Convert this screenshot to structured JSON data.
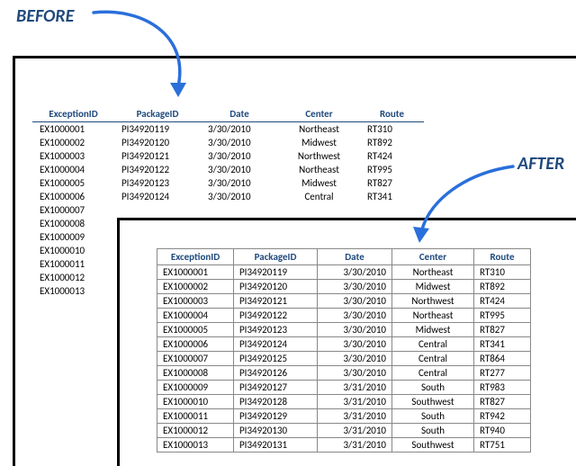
{
  "labels": {
    "before": "BEFORE",
    "after": "AFTER"
  },
  "columns": {
    "exception": "ExceptionID",
    "package": "PackageID",
    "date": "Date",
    "center": "Center",
    "route": "Route"
  },
  "before_rows": [
    {
      "exception": "EX1000001",
      "package": "PI34920119",
      "date": "3/30/2010",
      "center": "Northeast",
      "route": "RT310"
    },
    {
      "exception": "EX1000002",
      "package": "PI34920120",
      "date": "3/30/2010",
      "center": "Midwest",
      "route": "RT892"
    },
    {
      "exception": "EX1000003",
      "package": "PI34920121",
      "date": "3/30/2010",
      "center": "Northwest",
      "route": "RT424"
    },
    {
      "exception": "EX1000004",
      "package": "PI34920122",
      "date": "3/30/2010",
      "center": "Northeast",
      "route": "RT995"
    },
    {
      "exception": "EX1000005",
      "package": "PI34920123",
      "date": "3/30/2010",
      "center": "Midwest",
      "route": "RT827"
    },
    {
      "exception": "EX1000006",
      "package": "PI34920124",
      "date": "3/30/2010",
      "center": "Central",
      "route": "RT341"
    },
    {
      "exception": "EX1000007",
      "package": "",
      "date": "",
      "center": "",
      "route": ""
    },
    {
      "exception": "EX1000008",
      "package": "",
      "date": "",
      "center": "",
      "route": ""
    },
    {
      "exception": "EX1000009",
      "package": "",
      "date": "",
      "center": "",
      "route": ""
    },
    {
      "exception": "EX1000010",
      "package": "",
      "date": "",
      "center": "",
      "route": ""
    },
    {
      "exception": "EX1000011",
      "package": "",
      "date": "",
      "center": "",
      "route": ""
    },
    {
      "exception": "EX1000012",
      "package": "",
      "date": "",
      "center": "",
      "route": ""
    },
    {
      "exception": "EX1000013",
      "package": "",
      "date": "",
      "center": "",
      "route": ""
    }
  ],
  "after_rows": [
    {
      "exception": "EX1000001",
      "package": "PI34920119",
      "date": "3/30/2010",
      "center": "Northeast",
      "route": "RT310"
    },
    {
      "exception": "EX1000002",
      "package": "PI34920120",
      "date": "3/30/2010",
      "center": "Midwest",
      "route": "RT892"
    },
    {
      "exception": "EX1000003",
      "package": "PI34920121",
      "date": "3/30/2010",
      "center": "Northwest",
      "route": "RT424"
    },
    {
      "exception": "EX1000004",
      "package": "PI34920122",
      "date": "3/30/2010",
      "center": "Northeast",
      "route": "RT995"
    },
    {
      "exception": "EX1000005",
      "package": "PI34920123",
      "date": "3/30/2010",
      "center": "Midwest",
      "route": "RT827"
    },
    {
      "exception": "EX1000006",
      "package": "PI34920124",
      "date": "3/30/2010",
      "center": "Central",
      "route": "RT341"
    },
    {
      "exception": "EX1000007",
      "package": "PI34920125",
      "date": "3/30/2010",
      "center": "Central",
      "route": "RT864"
    },
    {
      "exception": "EX1000008",
      "package": "PI34920126",
      "date": "3/30/2010",
      "center": "Central",
      "route": "RT277"
    },
    {
      "exception": "EX1000009",
      "package": "PI34920127",
      "date": "3/31/2010",
      "center": "South",
      "route": "RT983"
    },
    {
      "exception": "EX1000010",
      "package": "PI34920128",
      "date": "3/31/2010",
      "center": "Southwest",
      "route": "RT827"
    },
    {
      "exception": "EX1000011",
      "package": "PI34920129",
      "date": "3/31/2010",
      "center": "South",
      "route": "RT942"
    },
    {
      "exception": "EX1000012",
      "package": "PI34920130",
      "date": "3/31/2010",
      "center": "South",
      "route": "RT940"
    },
    {
      "exception": "EX1000013",
      "package": "PI34920131",
      "date": "3/31/2010",
      "center": "Southwest",
      "route": "RT751"
    }
  ]
}
